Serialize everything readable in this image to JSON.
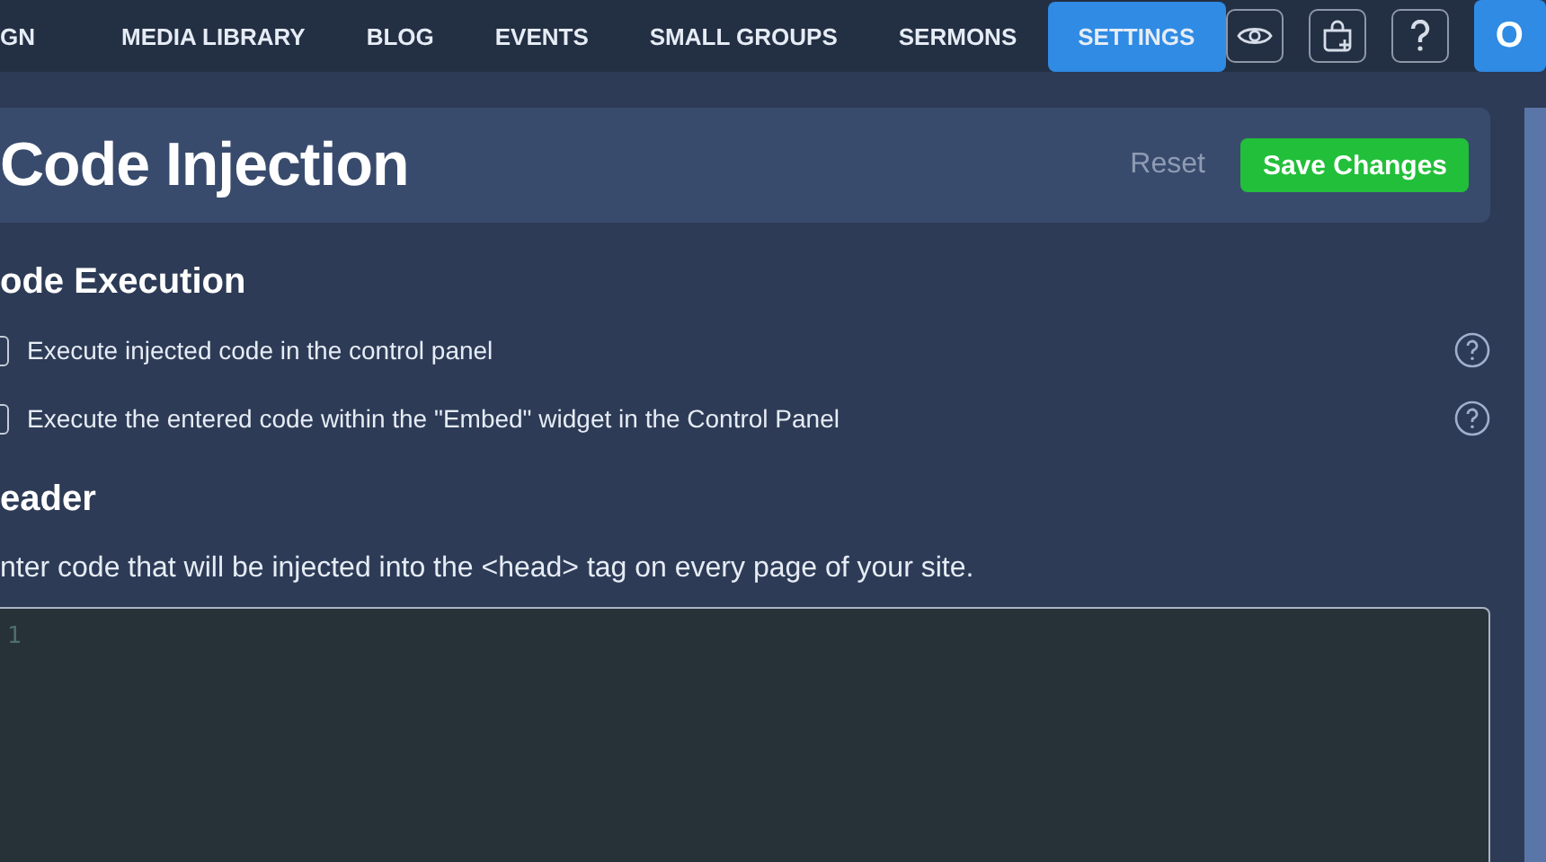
{
  "nav": {
    "items": [
      {
        "label": "GN",
        "selected": false
      },
      {
        "label": "MEDIA LIBRARY",
        "selected": false
      },
      {
        "label": "BLOG",
        "selected": false
      },
      {
        "label": "EVENTS",
        "selected": false
      },
      {
        "label": "SMALL GROUPS",
        "selected": false
      },
      {
        "label": "SERMONS",
        "selected": false
      },
      {
        "label": "SETTINGS",
        "selected": true
      }
    ],
    "avatar": "O"
  },
  "page": {
    "title": "Code Injection",
    "reset": "Reset",
    "save": "Save Changes"
  },
  "execution": {
    "heading": "ode Execution",
    "options": [
      {
        "label": "Execute injected code in the control panel",
        "checked": false
      },
      {
        "label": "Execute the entered code within the \"Embed\" widget in the Control Panel",
        "checked": false
      }
    ]
  },
  "header_section": {
    "heading": "eader",
    "description": "nter code that will be injected into the <head> tag on every page of your site.",
    "line_numbers": [
      "1"
    ]
  }
}
